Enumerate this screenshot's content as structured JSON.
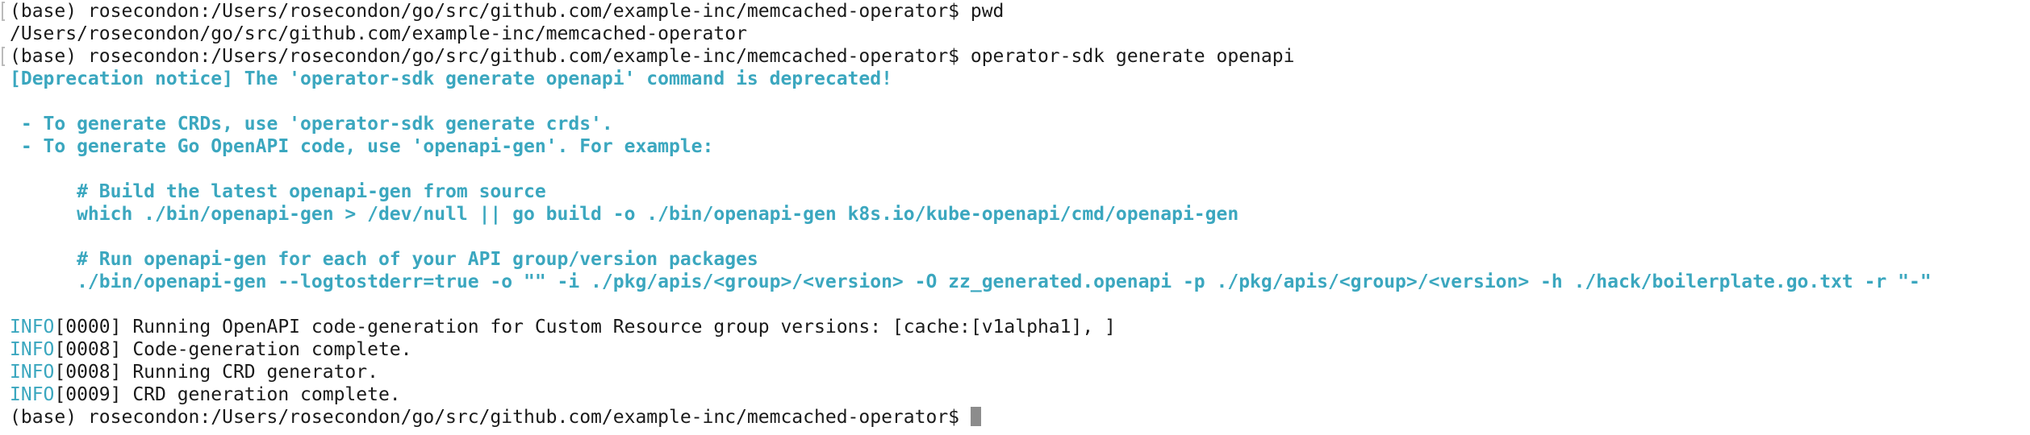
{
  "terminal": {
    "lines": [
      {
        "kind": "prompt",
        "prompt": "(base) rosecondon:/Users/rosecondon/go/src/github.com/example-inc/memcached-operator$ ",
        "cmd": "pwd"
      },
      {
        "kind": "output",
        "text": "/Users/rosecondon/go/src/github.com/example-inc/memcached-operator"
      },
      {
        "kind": "prompt",
        "prompt": "(base) rosecondon:/Users/rosecondon/go/src/github.com/example-inc/memcached-operator$ ",
        "cmd": "operator-sdk generate openapi"
      },
      {
        "kind": "warn",
        "text": "[Deprecation notice] The 'operator-sdk generate openapi' command is deprecated!"
      },
      {
        "kind": "blank"
      },
      {
        "kind": "warn",
        "text": " - To generate CRDs, use 'operator-sdk generate crds'."
      },
      {
        "kind": "warn",
        "text": " - To generate Go OpenAPI code, use 'openapi-gen'. For example:"
      },
      {
        "kind": "blank"
      },
      {
        "kind": "warn",
        "text": "      # Build the latest openapi-gen from source"
      },
      {
        "kind": "warn",
        "text": "      which ./bin/openapi-gen > /dev/null || go build -o ./bin/openapi-gen k8s.io/kube-openapi/cmd/openapi-gen"
      },
      {
        "kind": "blank"
      },
      {
        "kind": "warn",
        "text": "      # Run openapi-gen for each of your API group/version packages"
      },
      {
        "kind": "warn",
        "text": "      ./bin/openapi-gen --logtostderr=true -o \"\" -i ./pkg/apis/<group>/<version> -O zz_generated.openapi -p ./pkg/apis/<group>/<version> -h ./hack/boilerplate.go.txt -r \"-\""
      },
      {
        "kind": "blank"
      },
      {
        "kind": "info",
        "tag": "INFO",
        "text": "[0000] Running OpenAPI code-generation for Custom Resource group versions: [cache:[v1alpha1], ]"
      },
      {
        "kind": "info",
        "tag": "INFO",
        "text": "[0008] Code-generation complete."
      },
      {
        "kind": "info",
        "tag": "INFO",
        "text": "[0008] Running CRD generator."
      },
      {
        "kind": "info",
        "tag": "INFO",
        "text": "[0009] CRD generation complete."
      },
      {
        "kind": "prompt",
        "prompt": "(base) rosecondon:/Users/rosecondon/go/src/github.com/example-inc/memcached-operator$ ",
        "cmd": "",
        "cursor": true
      }
    ]
  },
  "colors": {
    "background": "#ffffff",
    "text": "#1a1a1a",
    "accent_cyan": "#3ba7bf",
    "cursor": "#8c8c8c"
  }
}
